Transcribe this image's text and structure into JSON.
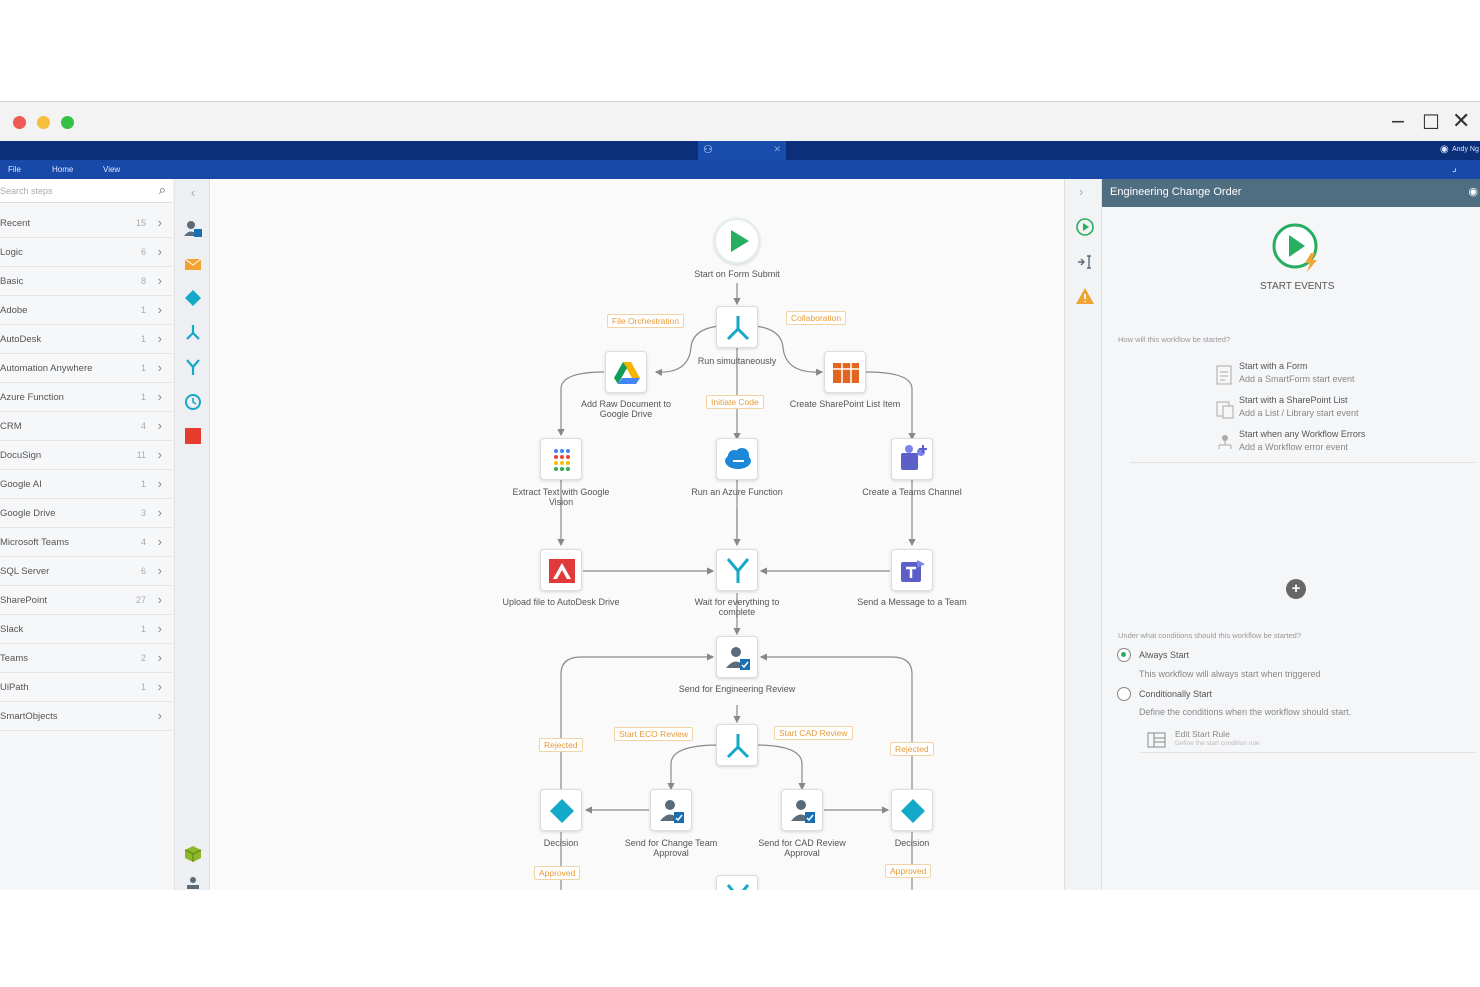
{
  "menu": {
    "file": "File",
    "home": "Home",
    "view": "View",
    "user": "Andy Ng"
  },
  "sidebar": {
    "search_placeholder": "Search steps",
    "categories": [
      {
        "label": "Recent",
        "count": "15"
      },
      {
        "label": "Logic",
        "count": "6"
      },
      {
        "label": "Basic",
        "count": "8"
      },
      {
        "label": "Adobe",
        "count": "1"
      },
      {
        "label": "AutoDesk",
        "count": "1"
      },
      {
        "label": "Automation Anywhere",
        "count": "1"
      },
      {
        "label": "Azure Function",
        "count": "1"
      },
      {
        "label": "CRM",
        "count": "4"
      },
      {
        "label": "DocuSign",
        "count": "11"
      },
      {
        "label": "Google AI",
        "count": "1"
      },
      {
        "label": "Google Drive",
        "count": "3"
      },
      {
        "label": "Microsoft Teams",
        "count": "4"
      },
      {
        "label": "SQL Server",
        "count": "6"
      },
      {
        "label": "SharePoint",
        "count": "27"
      },
      {
        "label": "Slack",
        "count": "1"
      },
      {
        "label": "Teams",
        "count": "2"
      },
      {
        "label": "UiPath",
        "count": "1"
      },
      {
        "label": "SmartObjects",
        "count": ""
      }
    ]
  },
  "workflow": {
    "nodes": {
      "start": "Start on Form Submit",
      "run_sim": "Run simultaneously",
      "google_drive": "Add Raw Document to Google Drive",
      "sharepoint": "Create SharePoint List Item",
      "vision": "Extract Text with Google Vision",
      "azure": "Run an Azure Function",
      "teams_channel": "Create a Teams Channel",
      "autodesk": "Upload file to AutoDesk Drive",
      "wait": "Wait for everything to complete",
      "teams_msg": "Send a Message to a Team",
      "eng_review": "Send for Engineering Review",
      "change_team": "Send for Change Team Approval",
      "cad_review": "Send for CAD Review Approval",
      "decision_left": "Decision",
      "decision_right": "Decision"
    },
    "tags": {
      "file_orch": "File Orchestration",
      "collab": "Collaboration",
      "initiate_code": "Initiate Code",
      "start_eco": "Start ECO Review",
      "start_cad": "Start CAD Review",
      "rejected_left": "Rejected",
      "rejected_right": "Rejected",
      "approved_left": "Approved",
      "approved_right": "Approved"
    }
  },
  "panel": {
    "title": "Engineering Change Order",
    "start_events": "START EVENTS",
    "q1": "How will this workflow be started?",
    "options": [
      {
        "title": "Start with a Form",
        "desc": "Add a SmartForm start event"
      },
      {
        "title": "Start with a SharePoint List",
        "desc": "Add a List / Library start event"
      },
      {
        "title": "Start when any Workflow Errors",
        "desc": "Add a Workflow error event"
      }
    ],
    "q2": "Under what conditions should this workflow be started?",
    "always_start": "Always Start",
    "always_start_desc": "This workflow will always start when triggered",
    "conditional_start": "Conditionally Start",
    "conditional_start_desc": "Define the conditions when the workflow should start.",
    "edit_rule": "Edit Start Rule",
    "edit_rule_desc": "Define the start condition rule"
  },
  "colors": {
    "accent_blue": "#0c2f7a",
    "ribbon_blue": "#1849a9",
    "panel_header": "#4f6e82",
    "green": "#27ae60",
    "teal": "#18a9c4",
    "tag_orange": "#e69a3a"
  }
}
